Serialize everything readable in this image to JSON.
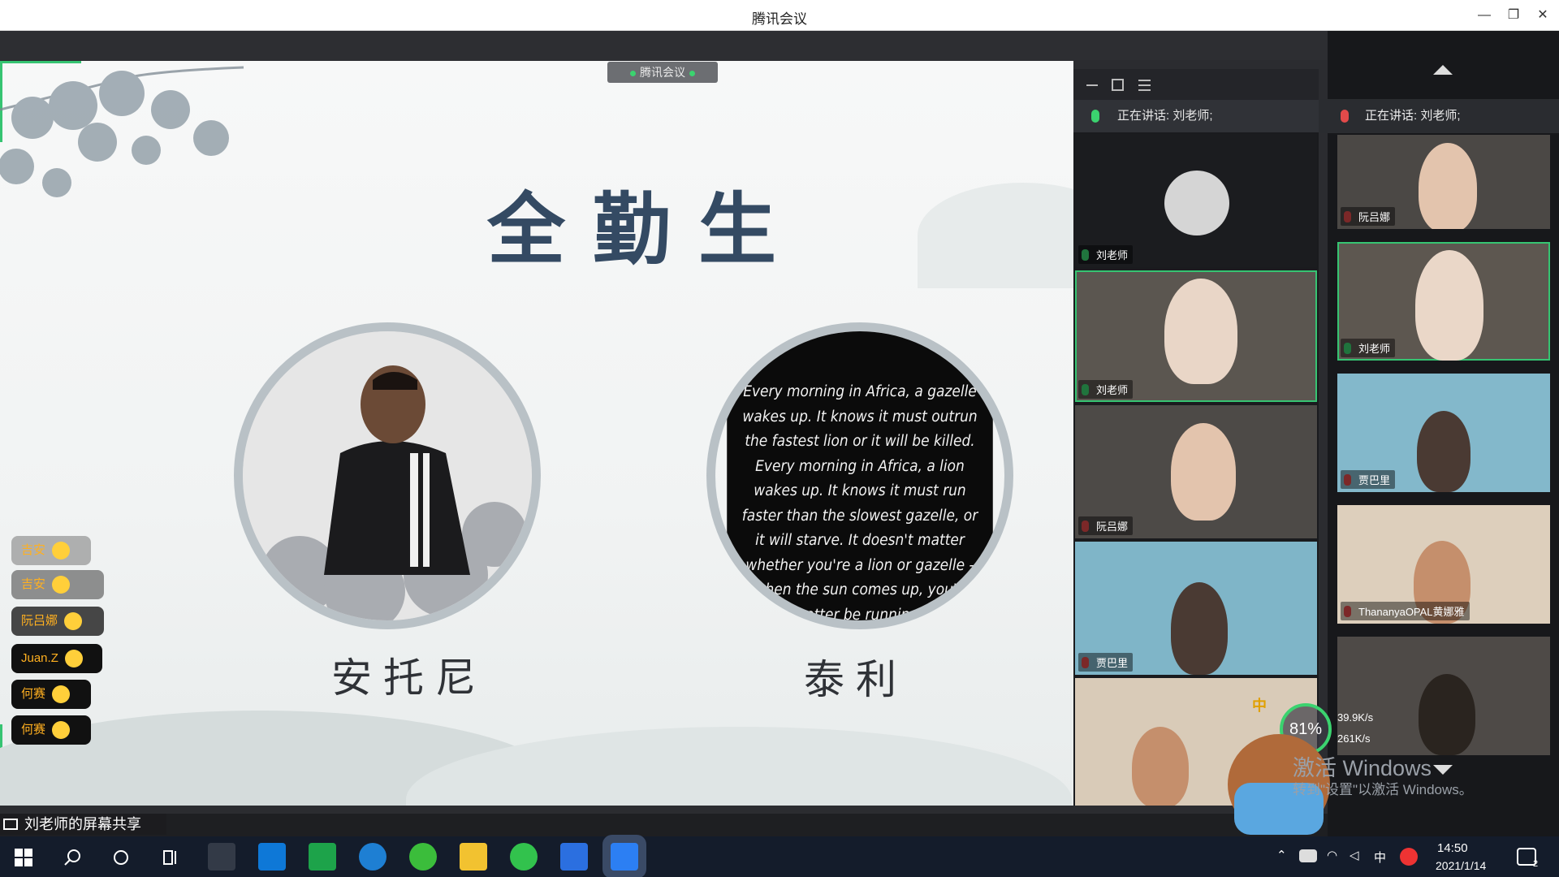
{
  "window": {
    "title": "腾讯会议",
    "minimize": "—",
    "maximize": "❐",
    "close": "✕"
  },
  "share_tag": {
    "label": "腾讯会议"
  },
  "slide": {
    "title": "全勤生",
    "left_name": "安托尼",
    "right_name": "泰利",
    "quote": "Every morning in Africa, a gazelle wakes up. It knows it must outrun the fastest lion or it will be killed. Every morning in Africa, a lion wakes up. It knows it must run faster than the slowest gazelle, or it will starve. It doesn't matter whether you're a lion or gazelle - when the sun comes up, you'd better be running."
  },
  "reactions": [
    {
      "name": "吉安"
    },
    {
      "name": "吉安"
    },
    {
      "name": "阮吕娜"
    },
    {
      "name": "Juan.Z"
    },
    {
      "name": "何赛"
    },
    {
      "name": "何赛"
    }
  ],
  "float_panel": {
    "speaking": "正在讲话: 刘老师;",
    "tiles": [
      {
        "name": "刘老师"
      },
      {
        "name": "刘老师"
      },
      {
        "name": "阮吕娜"
      },
      {
        "name": "贾巴里"
      },
      {
        "name": ""
      }
    ],
    "ime_badge": "中"
  },
  "right_col": {
    "speaking": "正在讲话: 刘老师;",
    "tiles": [
      {
        "name": "阮吕娜"
      },
      {
        "name": "刘老师"
      },
      {
        "name": "贾巴里"
      },
      {
        "name": "ThananyaOPAL黄娜雅"
      },
      {
        "name": ""
      }
    ],
    "net_up": "39.9K/s",
    "net_down": "261K/s",
    "cpu": "81%"
  },
  "status": {
    "screenshare": "刘老师的屏幕共享"
  },
  "watermark": {
    "line1": "激活 Windows",
    "line2": "转到\"设置\"以激活 Windows。"
  },
  "taskbar": {
    "ime": "中",
    "time": "14:50",
    "date": "2021/1/14",
    "notifications": "2"
  },
  "colors": {
    "accent_green": "#36c472",
    "title_blue": "#344a63",
    "taskbar": "#141c2b"
  }
}
